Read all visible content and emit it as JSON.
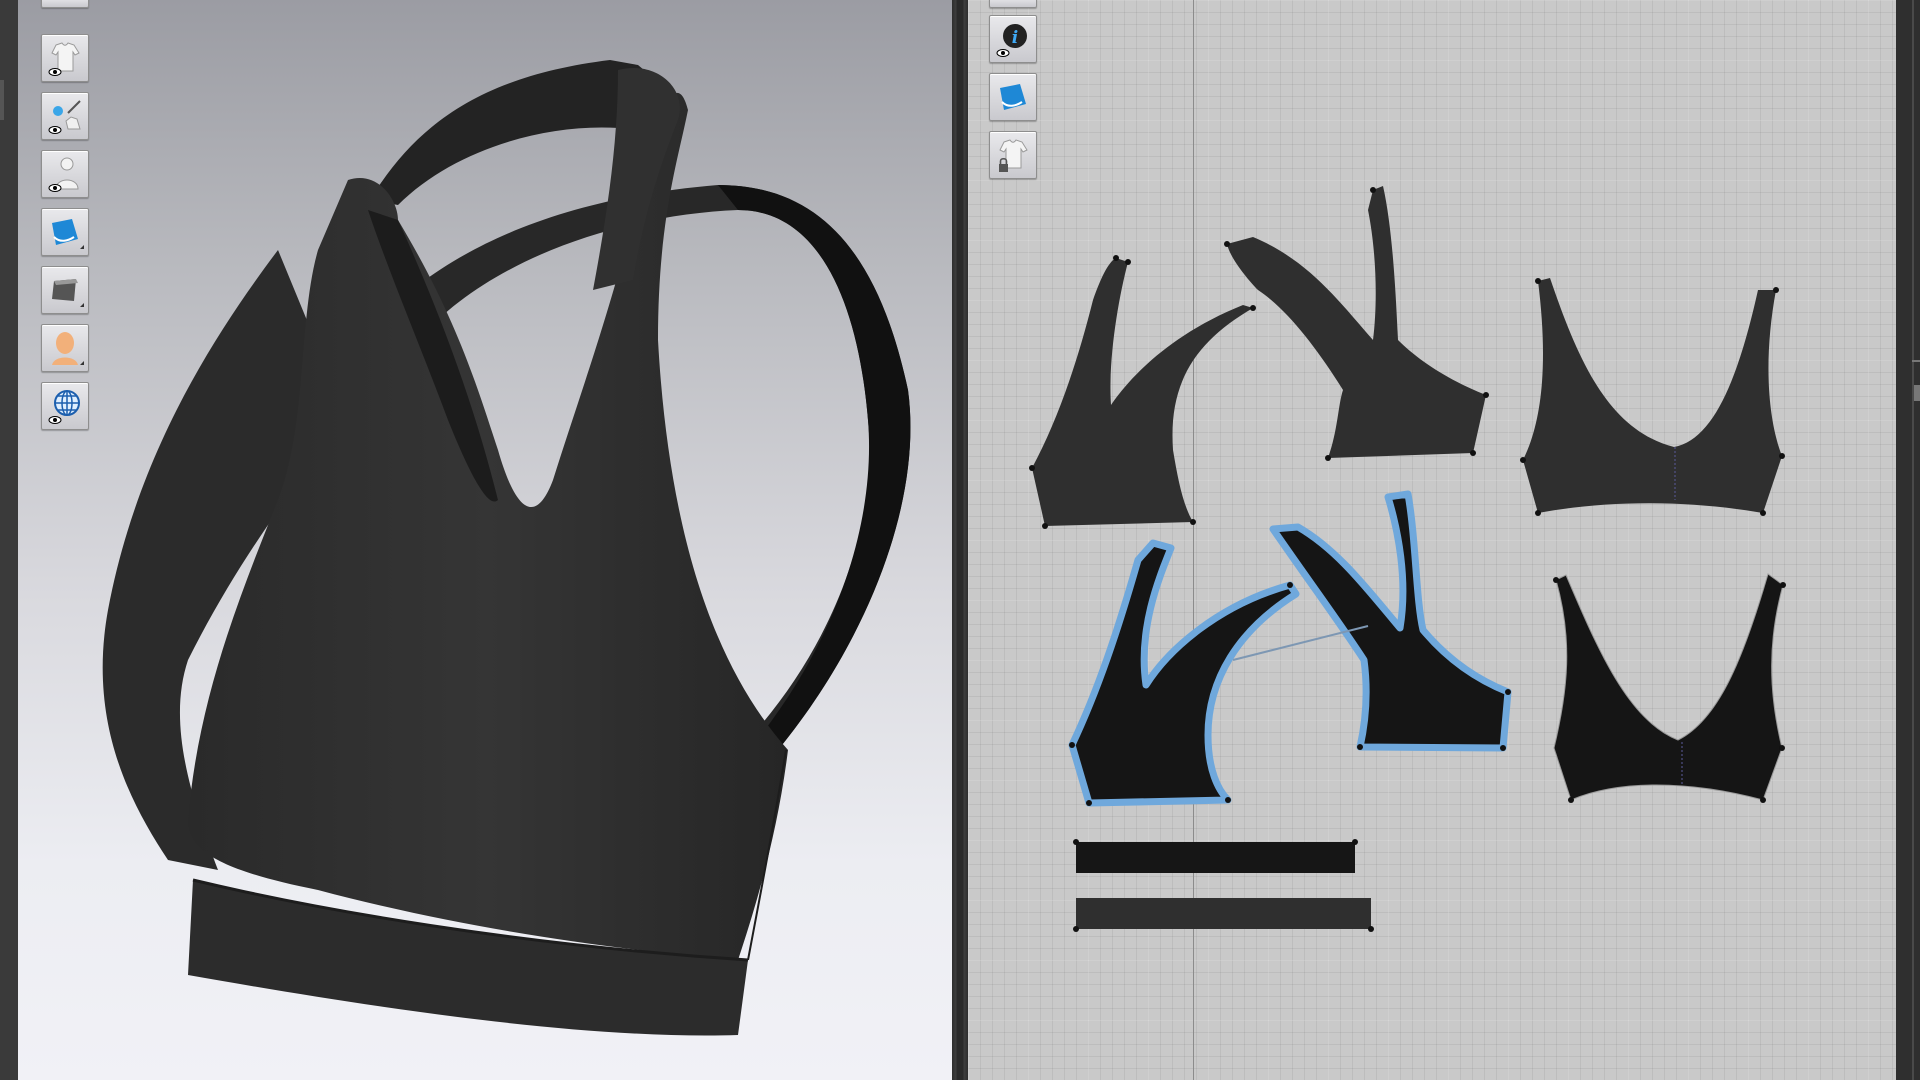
{
  "app": {
    "viewport_3d": {
      "background": [
        "#9b9ca3",
        "#f1f1f6"
      ],
      "toolbar": [
        {
          "id": "show-garment",
          "icon": "garment-eye-icon"
        },
        {
          "id": "show-trims",
          "icon": "trims-eye-icon"
        },
        {
          "id": "show-avatar",
          "icon": "avatar-eye-icon"
        },
        {
          "id": "texture-mode",
          "icon": "blue-texture-icon"
        },
        {
          "id": "thickness-render",
          "icon": "gray-fabric-icon"
        },
        {
          "id": "avatar-skin",
          "icon": "avatar-head-icon"
        },
        {
          "id": "environment",
          "icon": "globe-eye-icon"
        }
      ]
    },
    "viewport_2d": {
      "background": "#c9c9c9",
      "toolbar": [
        {
          "id": "show-info",
          "icon": "info-eye-icon"
        },
        {
          "id": "texture-2d",
          "icon": "blue-texture-icon"
        },
        {
          "id": "lock-garment",
          "icon": "locked-garment-icon"
        }
      ]
    },
    "colors": {
      "garment": "#2f2f2f",
      "selected_pattern": "#151515",
      "selection_outline": "#6fa8dc",
      "grid": "#c9c9c9"
    }
  }
}
